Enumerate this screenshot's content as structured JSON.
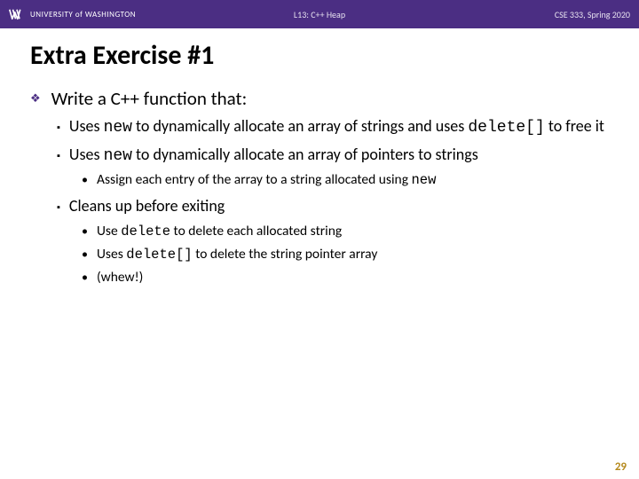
{
  "header": {
    "university": "UNIVERSITY of WASHINGTON",
    "lecture": "L13: C++ Heap",
    "course": "CSE 333, Spring 2020"
  },
  "title": "Extra Exercise #1",
  "content": {
    "write": "Write a C++ function that:",
    "b1_pre": "Uses ",
    "b1_code1": "new",
    "b1_mid": " to dynamically allocate an array of strings and uses ",
    "b1_code2": "delete[]",
    "b1_post": " to free it",
    "b2_pre": "Uses ",
    "b2_code1": "new",
    "b2_post": " to dynamically allocate an array of pointers to strings",
    "b2s1_pre": "Assign each entry of the array to a string allocated using ",
    "b2s1_code": "new",
    "b3": "Cleans up before exiting",
    "b3s1_pre": "Use ",
    "b3s1_code": "delete",
    "b3s1_post": " to delete each allocated string",
    "b3s2_pre": "Uses ",
    "b3s2_code": "delete[]",
    "b3s2_post": " to delete the string pointer array",
    "b3s3": "(whew!)"
  },
  "page_number": "29"
}
